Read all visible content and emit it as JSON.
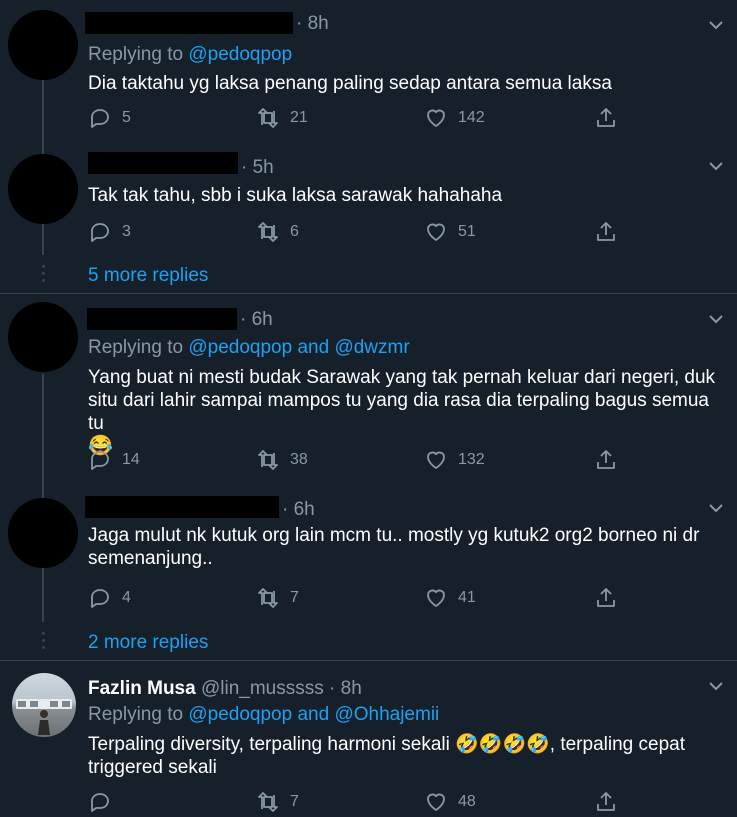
{
  "reply_prefix": "Replying to",
  "and_word": "and",
  "tweets": [
    {
      "time": "8h",
      "reply_handles": [
        "@pedoqpop"
      ],
      "text": "Dia taktahu yg laksa penang paling sedap antara semua laksa",
      "replies": "5",
      "retweets": "21",
      "likes": "142"
    },
    {
      "time": "5h",
      "text": "Tak tak tahu, sbb i suka laksa sarawak hahahaha",
      "replies": "3",
      "retweets": "6",
      "likes": "51"
    },
    {
      "time": "6h",
      "reply_handles": [
        "@pedoqpop",
        "@dwzmr"
      ],
      "text_line1": "Yang buat ni mesti budak Sarawak yang tak pernah keluar dari negeri, duk",
      "text_line2": "situ dari lahir sampai mampos tu yang dia rasa dia terpaling bagus semua tu",
      "emoji": "😂",
      "replies": "14",
      "retweets": "38",
      "likes": "132"
    },
    {
      "time": "6h",
      "text_line1": "Jaga mulut nk kutuk org lain mcm tu.. mostly yg kutuk2 org2 borneo ni dr",
      "text_line2": "semenanjung..",
      "replies": "4",
      "retweets": "7",
      "likes": "41"
    },
    {
      "name": "Fazlin Musa",
      "handle": "@lin_musssss",
      "time": "8h",
      "reply_handles": [
        "@pedoqpop",
        "@Ohhajemii"
      ],
      "text_line1": "Terpaling diversity, terpaling harmoni sekali 🤣🤣🤣🤣, terpaling cepat",
      "text_line2": "triggered sekali",
      "replies": "",
      "retweets": "7",
      "likes": "48"
    }
  ],
  "more_replies": [
    "5 more replies",
    "2 more replies"
  ],
  "icons": [
    "reply-icon",
    "retweet-icon",
    "like-icon",
    "share-icon",
    "chevron-down-icon"
  ],
  "colors": {
    "background": "#15202b",
    "muted": "#8899a6",
    "link": "#1da1f2",
    "divider": "#38444d"
  }
}
